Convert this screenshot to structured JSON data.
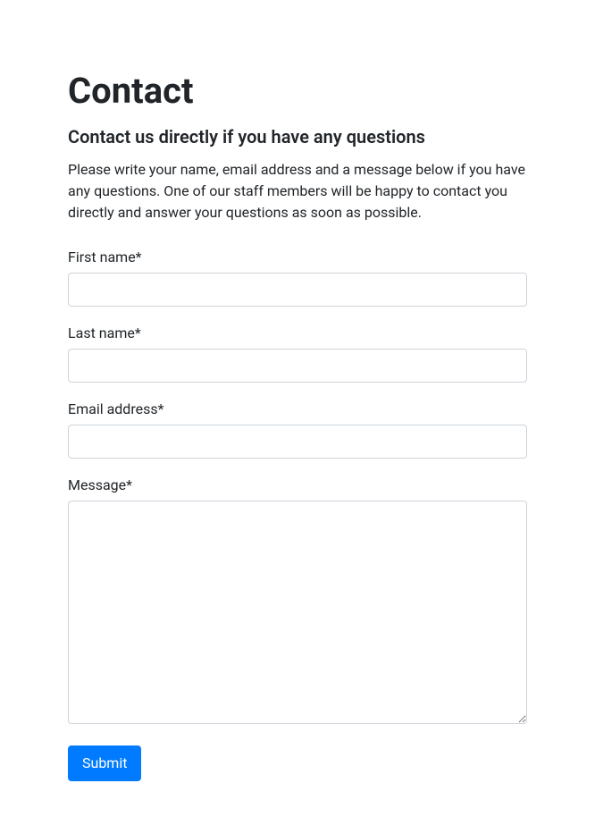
{
  "header": {
    "title": "Contact",
    "subtitle": "Contact us directly if you have any questions",
    "description": "Please write your name, email address and a message below if you have any questions. One of our staff members will be happy to contact you directly and answer your questions as soon as possible."
  },
  "form": {
    "first_name": {
      "label": "First name*",
      "value": ""
    },
    "last_name": {
      "label": "Last name*",
      "value": ""
    },
    "email": {
      "label": "Email address*",
      "value": ""
    },
    "message": {
      "label": "Message*",
      "value": ""
    },
    "submit_label": "Submit"
  }
}
